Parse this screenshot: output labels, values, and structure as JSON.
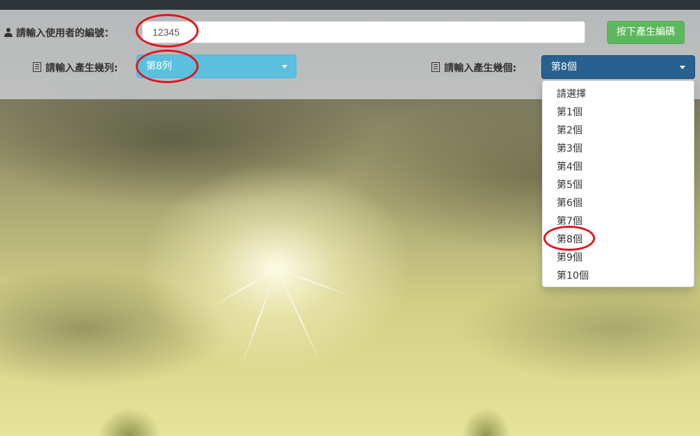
{
  "header": {
    "user_label": "請輸入使用者的編號：",
    "user_input_value": "12345",
    "generate_button_label": "按下產生編碼",
    "rows_label": "請輸入產生幾列:",
    "rows_selected": "第8列",
    "count_label": "請輸入產生幾個:",
    "count_selected": "第8個"
  },
  "dropdown": {
    "options": [
      "請選擇",
      "第1個",
      "第2個",
      "第3個",
      "第4個",
      "第5個",
      "第6個",
      "第7個",
      "第8個",
      "第9個",
      "第10個"
    ]
  },
  "colors": {
    "generate_button": "#5cb85c",
    "rows_select": "#5bc0de",
    "count_select": "#286090",
    "annotation": "#e3141d"
  },
  "icons": {
    "user": "user-icon",
    "list": "list-icon",
    "caret": "caret-down-icon"
  }
}
